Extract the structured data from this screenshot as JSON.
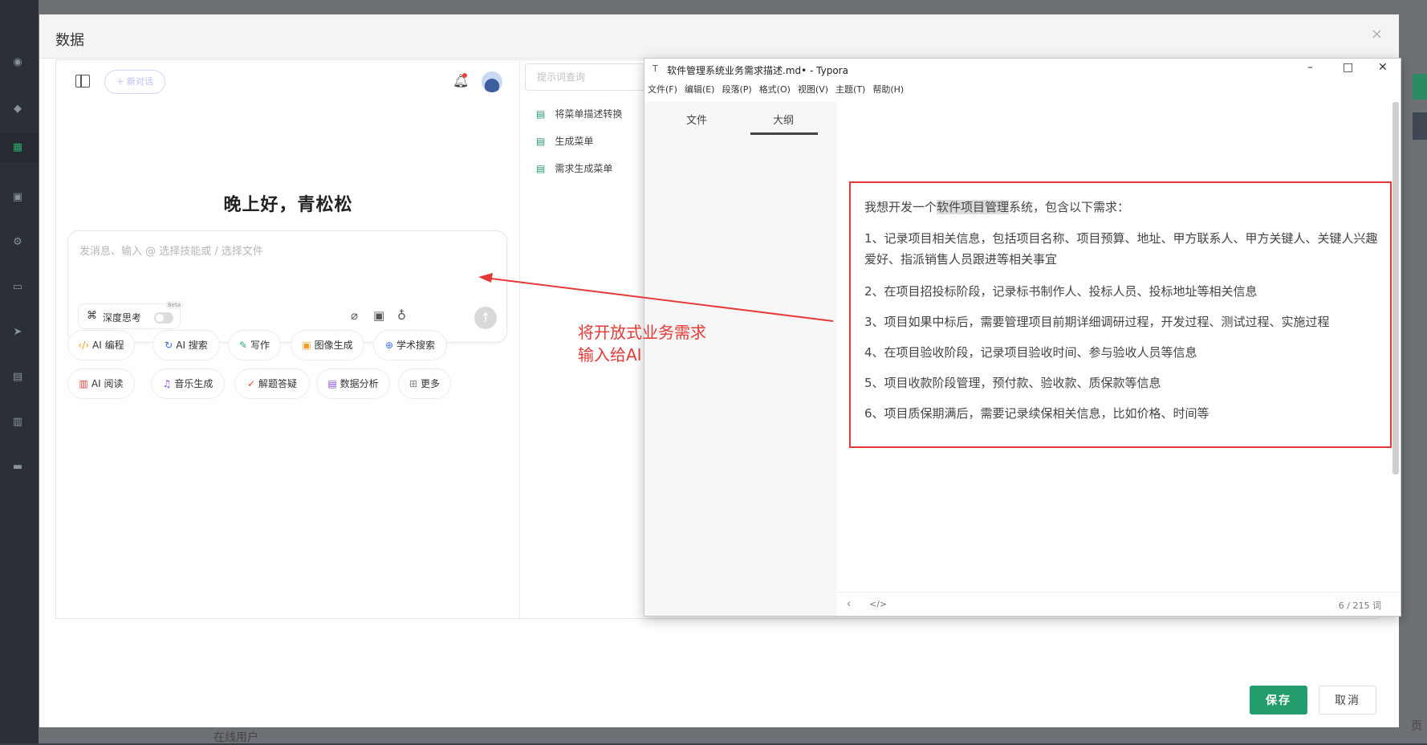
{
  "modal": {
    "title": "数据",
    "close_icon": "×",
    "save_label": "保存",
    "cancel_label": "取消"
  },
  "background": {
    "online_users": "在线用户",
    "page_text": "页"
  },
  "chat": {
    "new_chat_label": "+ 新对话",
    "greeting": "晚上好，青松松",
    "input_placeholder": "发消息、输入 @ 选择技能或 / 选择文件",
    "deep_think_label": "深度思考",
    "beta": "Beta",
    "chips": [
      {
        "icon": "‹/›",
        "label": "AI 编程",
        "color": "#f0a020"
      },
      {
        "icon": "↻",
        "label": "AI 搜索",
        "color": "#3a6ff0"
      },
      {
        "icon": "✎",
        "label": "写作",
        "color": "#2aa86a"
      },
      {
        "icon": "▣",
        "label": "图像生成",
        "color": "#f0a020"
      },
      {
        "icon": "⊕",
        "label": "学术搜索",
        "color": "#3a6ff0"
      },
      {
        "icon": "▥",
        "label": "AI 阅读",
        "color": "#e04040"
      },
      {
        "icon": "♫",
        "label": "音乐生成",
        "color": "#8a4ae0"
      },
      {
        "icon": "✓",
        "label": "解题答疑",
        "color": "#e04040"
      },
      {
        "icon": "▤",
        "label": "数据分析",
        "color": "#8a4ae0"
      },
      {
        "icon": "⊞",
        "label": "更多",
        "color": "#888888"
      }
    ]
  },
  "history": {
    "search_placeholder": "提示词查询",
    "items": [
      "将菜单描述转换",
      "生成菜单",
      "需求生成菜单"
    ]
  },
  "typora": {
    "logo": "T",
    "title": "软件管理系统业务需求描述.md• - Typora",
    "menus": [
      "文件(F)",
      "编辑(E)",
      "段落(P)",
      "格式(O)",
      "视图(V)",
      "主题(T)",
      "帮助(H)"
    ],
    "tabs": [
      "文件",
      "大纲"
    ],
    "word_count": "6 / 215 词",
    "intro_pre": "我想开发一个",
    "intro_hl": "软件项目管理",
    "intro_post": "系统，包含以下需求：",
    "requirements": [
      "1、记录项目相关信息，包括项目名称、项目预算、地址、甲方联系人、甲方关键人、关键人兴趣爱好、指派销售人员跟进等相关事宜",
      "2、在项目招投标阶段，记录标书制作人、投标人员、投标地址等相关信息",
      "3、项目如果中标后，需要管理项目前期详细调研过程，开发过程、测试过程、实施过程",
      "4、在项目验收阶段，记录项目验收时间、参与验收人员等信息",
      "5、项目收款阶段管理，预付款、验收款、质保款等信息",
      "6、项目质保期满后，需要记录续保相关信息，比如价格、时间等"
    ]
  },
  "annotation": {
    "line1": "将开放式业务需求",
    "line2": "输入给AI",
    "color": "#e53935"
  }
}
